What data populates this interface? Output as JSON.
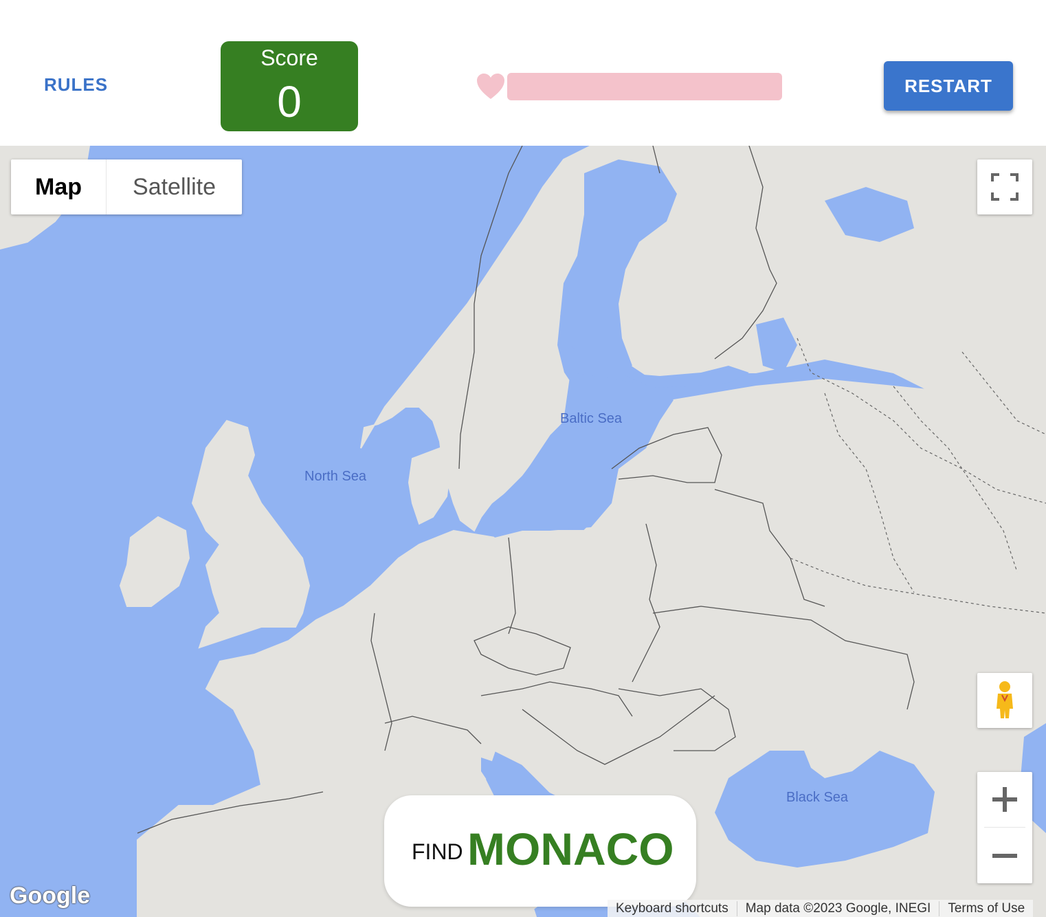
{
  "header": {
    "rules_label": "RULES",
    "score_label": "Score",
    "score_value": "0",
    "lives_fraction": 1.0,
    "restart_label": "RESTART"
  },
  "map": {
    "map_type": {
      "map_label": "Map",
      "satellite_label": "Satellite",
      "selected": "Map"
    },
    "seas": {
      "north_sea": "North Sea",
      "baltic_sea": "Baltic Sea",
      "black_sea": "Black Sea"
    },
    "google_logo": "Google",
    "attribution": {
      "shortcuts": "Keyboard shortcuts",
      "map_data": "Map data ©2023 Google, INEGI",
      "terms": "Terms of Use"
    }
  },
  "prompt": {
    "prefix": "FIND",
    "target": "MONACO"
  },
  "colors": {
    "water": "#91b3f2",
    "land": "#e4e3df",
    "score_green": "#367f22",
    "restart_blue": "#3a75cc",
    "heart_pink": "#f4c2cb"
  },
  "icons": [
    "heart-icon",
    "fullscreen-icon",
    "pegman-icon",
    "zoom-in-icon",
    "zoom-out-icon"
  ]
}
